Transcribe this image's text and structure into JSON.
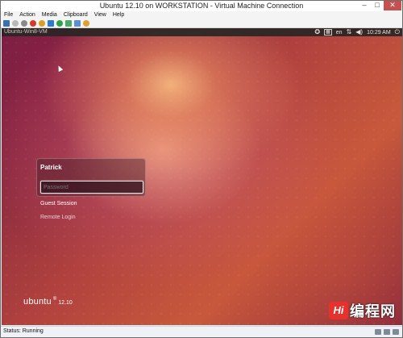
{
  "window": {
    "title": "Ubuntu 12.10 on WORKSTATION - Virtual Machine Connection",
    "minimize_glyph": "–",
    "maximize_glyph": "□",
    "close_glyph": "✕"
  },
  "menu": {
    "items": [
      "File",
      "Action",
      "Media",
      "Clipboard",
      "View",
      "Help"
    ]
  },
  "toolbar": {
    "icons": [
      "ctrl-alt-del-icon",
      "start-icon",
      "turn-off-icon",
      "shutdown-icon",
      "save-icon",
      "pause-icon",
      "reset-icon",
      "snapshot-icon",
      "revert-icon",
      "enhanced-session-icon"
    ]
  },
  "panel": {
    "vm_name": "Ubuntu-Win8-VM",
    "keyboard": "en",
    "clock": "10:29 AM"
  },
  "login": {
    "user_name": "Patrick",
    "password_placeholder": "Password",
    "guest_session": "Guest Session",
    "remote_login": "Remote Login"
  },
  "logo": {
    "word": "ubuntu",
    "mark": "®",
    "version": "12.10"
  },
  "watermark": {
    "badge": "Hi",
    "text": "编程网"
  },
  "status": {
    "text": "Status: Running"
  },
  "colors": {
    "panel": "#282624",
    "close_button": "#c75050",
    "wallpaper_dark": "#6e1d40",
    "wallpaper_light": "#f2b07a",
    "watermark_red": "#e5322d"
  }
}
